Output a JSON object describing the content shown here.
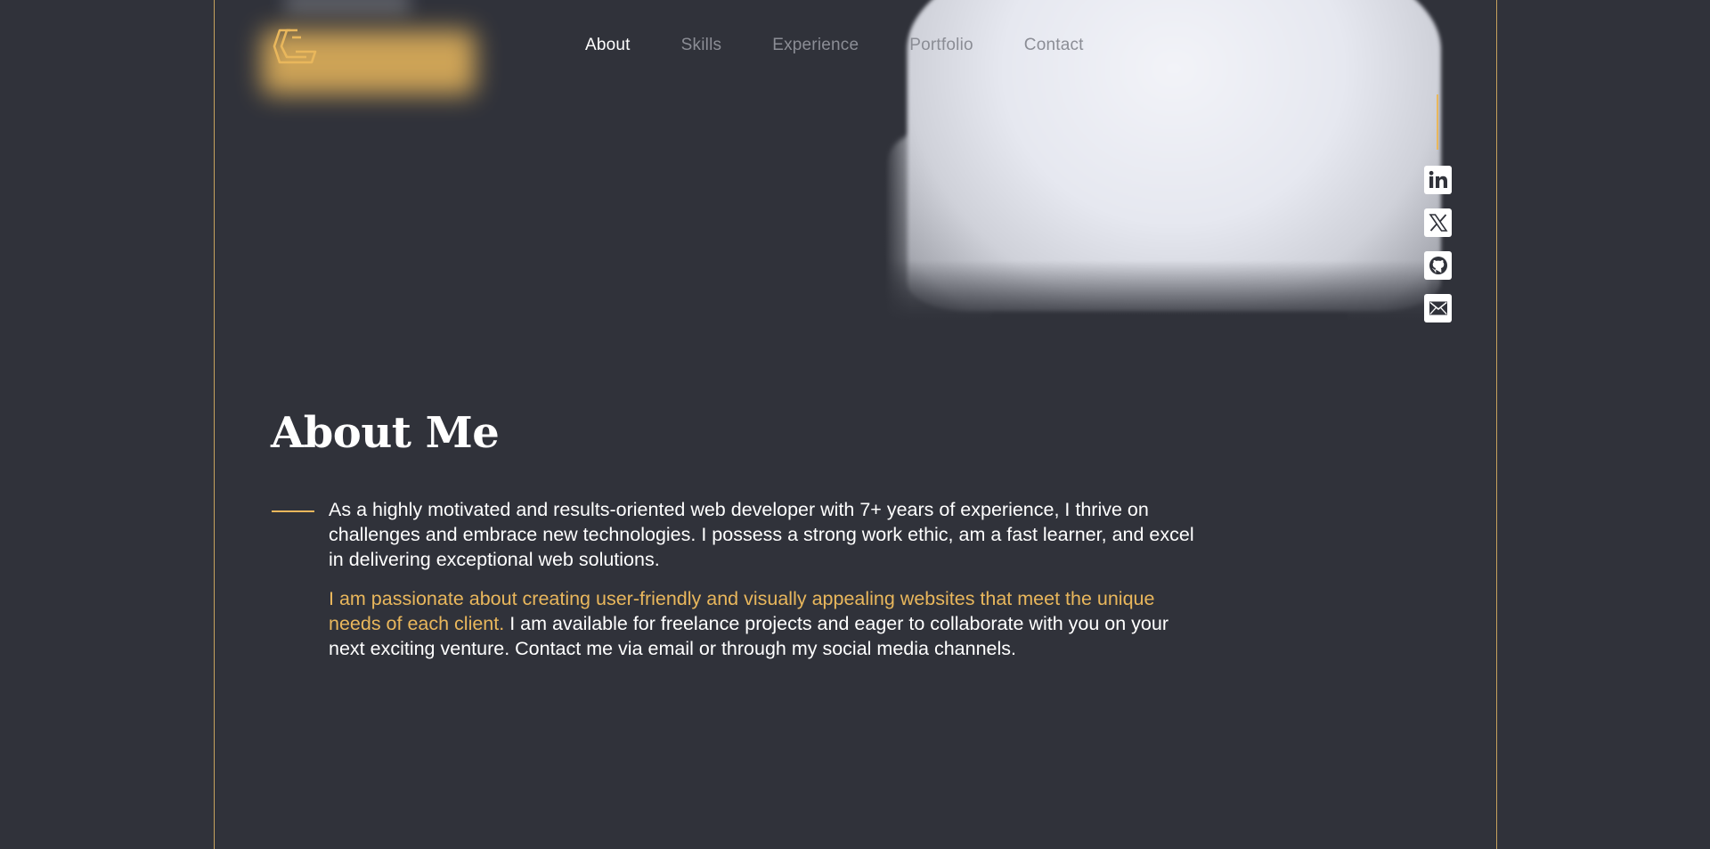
{
  "header": {
    "nav": [
      {
        "label": "About",
        "active": true
      },
      {
        "label": "Skills",
        "active": false
      },
      {
        "label": "Experience",
        "active": false
      },
      {
        "label": "Portfolio",
        "active": false
      },
      {
        "label": "Contact",
        "active": false
      }
    ]
  },
  "social": {
    "icons": [
      "linkedin-icon",
      "x-twitter-icon",
      "github-icon",
      "email-icon"
    ]
  },
  "about": {
    "title": "About Me",
    "paragraph1": "As a highly motivated and results-oriented web developer with 7+ years of experience, I thrive on challenges and embrace new technologies. I possess a strong work ethic, am a fast learner, and excel in delivering exceptional web solutions.",
    "paragraph2_highlight": "I am passionate about creating user-friendly and visually appealing websites that meet the unique needs of each client.",
    "paragraph2_rest": " I am available for freelance projects and eager to collaborate with you on your next exciting venture. Contact me via email or through my social media channels."
  },
  "colors": {
    "background": "#30323a",
    "accent": "#e9b75c",
    "frame_border": "#c6a25e",
    "text": "#ffffff",
    "nav_inactive": "#8b8d95"
  }
}
